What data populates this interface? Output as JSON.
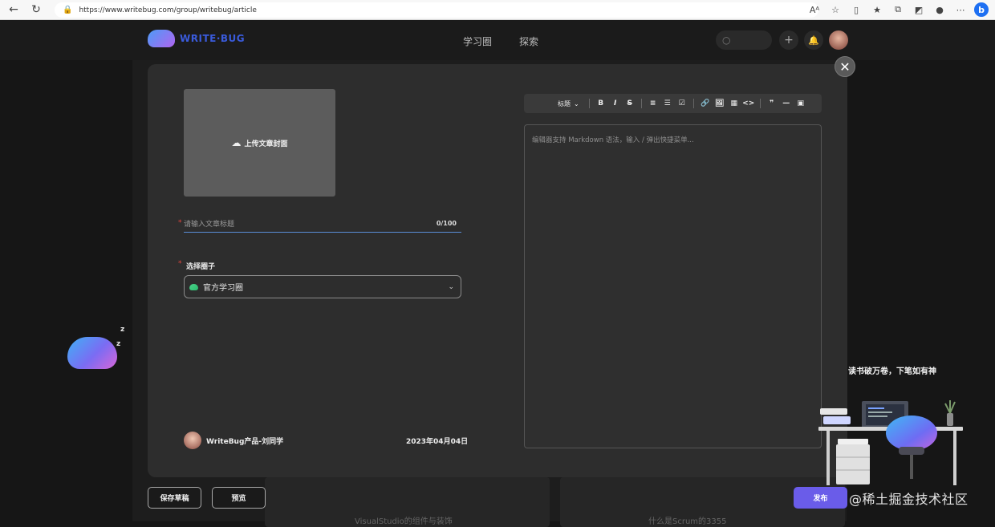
{
  "browser": {
    "url": "https://www.writebug.com/group/writebug/article",
    "icons": [
      "back-icon",
      "refresh-icon",
      "lock-icon",
      "read-aloud-icon",
      "favorite-add-icon",
      "split-screen-icon",
      "favorites-icon",
      "collections-icon",
      "extension-icon",
      "profile-icon",
      "more-icon",
      "bing-icon"
    ],
    "bing_label": "b"
  },
  "site": {
    "logo_text": "WRITE·BUG",
    "nav": [
      "学习圈",
      "探索"
    ],
    "plus_label": "+",
    "colors": {
      "logo_text": "#3a5bdc",
      "accent": "#6a5ce9"
    }
  },
  "background": {
    "cards": [
      "VisualStudio的组件与装饰",
      "什么是Scrum的3355"
    ]
  },
  "modal": {
    "close_label": "✕",
    "cover_upload_label": "上传文章封面",
    "title_placeholder": "请输入文章标题",
    "title_counter": "0/100",
    "circle_label": "选择圈子",
    "circle_value": "官方学习圈",
    "author_name": "WriteBug产品-刘同学",
    "date": "2023年04月04日",
    "toolbar": {
      "heading_label": "标题",
      "buttons": [
        "B",
        "I",
        "S",
        "≡",
        "☰",
        "☑",
        "🔗",
        "🖼",
        "▦",
        "<>",
        "❞",
        "—",
        "▣"
      ]
    },
    "editor_placeholder": "编辑器支持 Markdown 语法，输入 / 弹出快捷菜单..."
  },
  "footer": {
    "save_draft": "保存草稿",
    "preview": "预览",
    "publish": "发布"
  },
  "promo": {
    "slogan": "读书破万卷，下笔如有神",
    "watermark": "@稀土掘金技术社区"
  },
  "mascot": {
    "z1": "z",
    "z2": "z"
  }
}
